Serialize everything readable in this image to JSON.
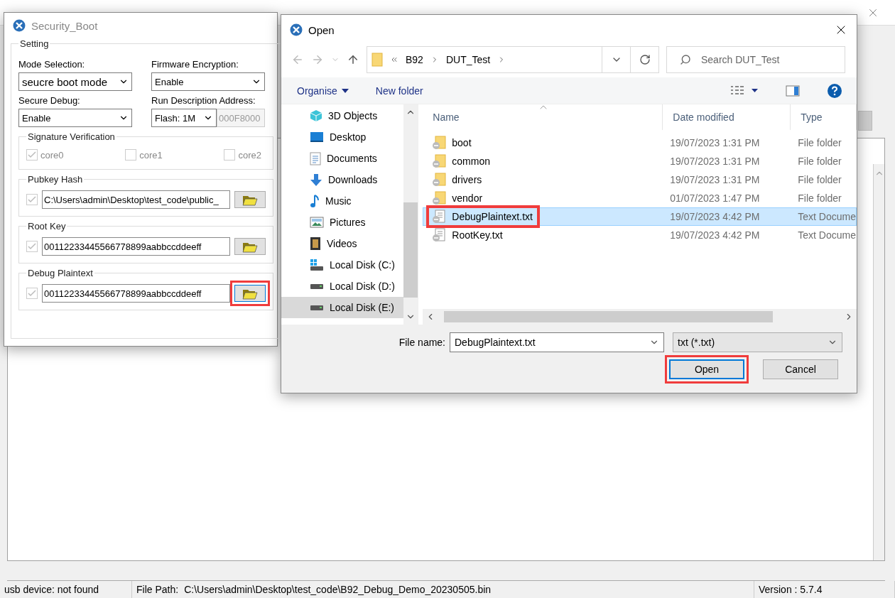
{
  "security_boot": {
    "title": "Security_Boot",
    "setting_title": "Setting",
    "mode_selection": {
      "label": "Mode Selection:",
      "value": "seucre boot mode"
    },
    "firmware_encryption": {
      "label": "Firmware Encryption:",
      "value": "Enable"
    },
    "secure_debug": {
      "label": "Secure Debug:",
      "value": "Enable"
    },
    "run_description_address": {
      "label": "Run Description Address:",
      "value": "Flash: 1M",
      "address": "000F8000",
      "address_disabled": true
    },
    "signature_verification": {
      "title": "Signature  Verification",
      "cores": [
        {
          "label": "core0",
          "checked": true
        },
        {
          "label": "core1",
          "checked": false
        },
        {
          "label": "core2",
          "checked": false
        }
      ]
    },
    "keys": [
      {
        "title": "Pubkey Hash",
        "checked": true,
        "value": "C:\\Users\\admin\\Desktop\\test_code\\public_",
        "highlighted": false
      },
      {
        "title": "Root Key",
        "checked": true,
        "value": "00112233445566778899aabbccddeeff",
        "highlighted": false
      },
      {
        "title": "Debug Plaintext",
        "checked": true,
        "value": "00112233445566778899aabbccddeeff",
        "highlighted": true
      }
    ]
  },
  "open_dialog": {
    "title": "Open",
    "breadcrumb": [
      "B92",
      "DUT_Test"
    ],
    "search": {
      "placeholder": "Search DUT_Test"
    },
    "toolbar": {
      "organise": "Organise",
      "new_folder": "New folder"
    },
    "nav_items": [
      {
        "label": "3D Objects",
        "kind": "objects",
        "selected": false
      },
      {
        "label": "Desktop",
        "kind": "desktop",
        "selected": false
      },
      {
        "label": "Documents",
        "kind": "documents",
        "selected": false
      },
      {
        "label": "Downloads",
        "kind": "downloads",
        "selected": false
      },
      {
        "label": "Music",
        "kind": "music",
        "selected": false
      },
      {
        "label": "Pictures",
        "kind": "pictures",
        "selected": false
      },
      {
        "label": "Videos",
        "kind": "videos",
        "selected": false
      },
      {
        "label": "Local Disk (C:)",
        "kind": "system-drive",
        "selected": false
      },
      {
        "label": "Local Disk (D:)",
        "kind": "drive",
        "selected": false
      },
      {
        "label": "Local Disk (E:)",
        "kind": "drive",
        "selected": true
      }
    ],
    "columns": [
      "Name",
      "Date modified",
      "Type"
    ],
    "files": [
      {
        "name": "boot",
        "date": "19/07/2023 1:31 PM",
        "type": "File folder",
        "kind": "folder",
        "selected": false,
        "highlighted": false
      },
      {
        "name": "common",
        "date": "19/07/2023 1:31 PM",
        "type": "File folder",
        "kind": "folder",
        "selected": false,
        "highlighted": false
      },
      {
        "name": "drivers",
        "date": "19/07/2023 1:31 PM",
        "type": "File folder",
        "kind": "folder",
        "selected": false,
        "highlighted": false
      },
      {
        "name": "vendor",
        "date": "01/07/2023 1:47 PM",
        "type": "File folder",
        "kind": "folder",
        "selected": false,
        "highlighted": false
      },
      {
        "name": "DebugPlaintext.txt",
        "date": "19/07/2023 4:42 PM",
        "type": "Text Docume",
        "kind": "text",
        "selected": true,
        "highlighted": true
      },
      {
        "name": "RootKey.txt",
        "date": "19/07/2023 4:42 PM",
        "type": "Text Docume",
        "kind": "text",
        "selected": false,
        "highlighted": false
      }
    ],
    "file_name": {
      "label": "File name:",
      "value": "DebugPlaintext.txt"
    },
    "filter": "txt (*.txt)",
    "buttons": [
      {
        "label": "Open",
        "default": true,
        "highlighted": true
      },
      {
        "label": "Cancel",
        "default": false,
        "highlighted": false
      }
    ]
  },
  "status_bar": {
    "device": "usb device: not found",
    "file_path_label": "File Path:",
    "file_path": "C:\\Users\\admin\\Desktop\\test_code\\B92_Debug_Demo_20230505.bin",
    "version": "Version : 5.7.4"
  }
}
